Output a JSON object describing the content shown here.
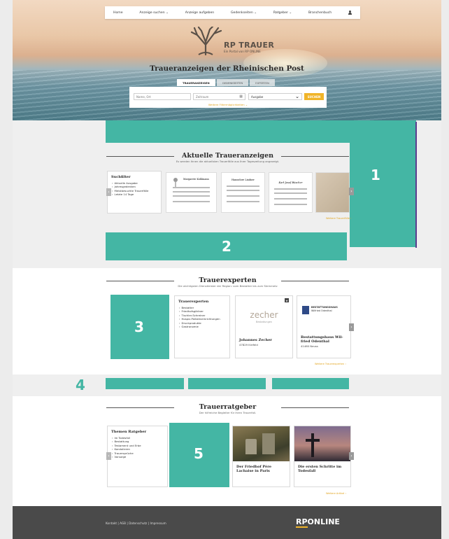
{
  "nav": {
    "items": [
      "Home",
      "Anzeige suchen ⌄",
      "Anzeige aufgeben",
      "Gedenkseiten ⌄",
      "Ratgeber ⌄",
      "Branchenbuch"
    ]
  },
  "brand": {
    "title": "RP TRAUER",
    "subtitle": "Ein Portal von RP ONLINE"
  },
  "hero": {
    "title": "Traueranzeigen der Rheinischen Post"
  },
  "search": {
    "tabs": [
      "TRAUERANZEIGEN",
      "GEDENKSEITEN",
      "EXPERTEN"
    ],
    "name_placeholder": "Name, Ort",
    "period_placeholder": "Zeitraum",
    "issue_value": "Ausgabe",
    "submit_label": "SUCHEN",
    "more_filters": "Weitere Filtermöglichkeiten ⌄"
  },
  "annotations": {
    "n1": "1",
    "n2": "2",
    "n3": "3",
    "n4": "4",
    "n5": "5"
  },
  "obituaries": {
    "heading": "Aktuelle Traueranzeigen",
    "subheading": "Es werden Ihnen die aktuellsten Trauerfälle aus Ihrer Tageszeitung angezeigt.",
    "filter_title": "Suchfilter",
    "filters": [
      "Aktuelle Ausgabe",
      "Jahresgedenken",
      "Meistbesuchte Trauerfälle",
      "Letzte 14 Tage"
    ],
    "notice_names": [
      "Margarete Kohlmann",
      "Hannelore Lindner",
      "Karl-Josef Büscher"
    ],
    "more": "Weitere Trauerfälle ›"
  },
  "experts": {
    "heading": "Trauerexperten",
    "subheading": "Die wichtigsten Dienstleister der Region: vom Bestatter bis zum Steinmetz",
    "list_title": "Trauerexperten",
    "list": [
      "Bestatter",
      "Friedhofsgärtner",
      "Tischler-Schreiner",
      "Hospiz-Palliativeinrichtungen",
      "Druckprodukte",
      "Gastronomie"
    ],
    "card1_logo": "zecher",
    "card1_logo_sub": "Bestattungen",
    "card1_name": "Johannes Zecher",
    "card1_city": "47829 Krefeld",
    "card2_logo": "BESTATTUNGSHAUS",
    "card2_logo_sub": "Wilfried Odenthal",
    "card2_name": "Bestattungshaus Wil-fried Odenthal",
    "card2_city": "41460 Neuss",
    "more": "Weitere Trauerexperten ›"
  },
  "guide": {
    "heading": "Trauerratgeber",
    "subheading": "Der hilfreiche Begleiter für Ihren Trauerfall.",
    "list_title": "Themen Ratgeber",
    "list": [
      "Im Todesfall",
      "Bestattung",
      "Testament und Erbe",
      "Kondolieren",
      "Trauersprüche",
      "Vorsorge"
    ],
    "article1": "Der Friedhof Père Lachaise in Paris",
    "article2": "Die ersten Schritte im Todesfall",
    "more": "Weitere Artikel ›"
  },
  "footer": {
    "links": "Kontakt  |  AGB  |  Datenschutz  |  Impressum",
    "logo_rp": "RP",
    "logo_online": "ONLINE"
  },
  "colors": {
    "annotation": "#44b6a4",
    "accent": "#f0b429"
  }
}
